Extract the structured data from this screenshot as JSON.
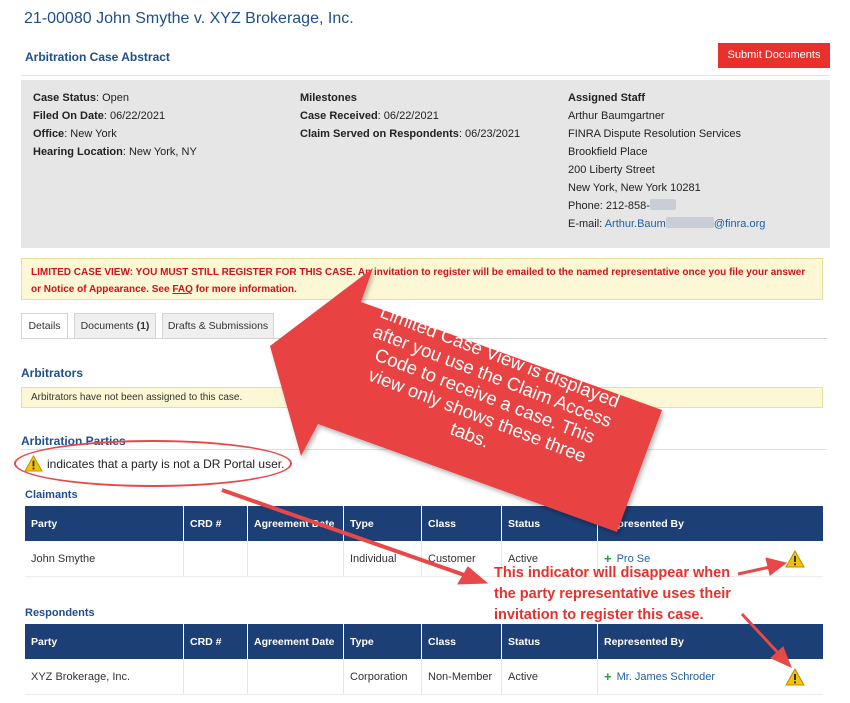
{
  "header": {
    "case_title": "21-00080 John Smythe v. XYZ Brokerage, Inc.",
    "abstract_title": "Arbitration Case Abstract",
    "submit_label": "Submit Documents"
  },
  "summary": {
    "case_status_label": "Case Status",
    "case_status_value": ": Open",
    "filed_label": "Filed On Date",
    "filed_value": ": 06/22/2021",
    "office_label": "Office",
    "office_value": ": New York",
    "hearing_label": "Hearing Location",
    "hearing_value": ": New York, NY",
    "milestones_title": "Milestones",
    "received_label": "Case Received",
    "received_value": ": 06/22/2021",
    "served_label": "Claim Served on Respondents",
    "served_value": ": 06/23/2021",
    "staff_title": "Assigned Staff",
    "staff_lines": [
      "Arthur Baumgartner",
      "FINRA Dispute Resolution Services",
      "Brookfield Place",
      "200 Liberty Street",
      "New York, New York 10281"
    ],
    "phone_label": "Phone: 212-858-",
    "email_label": "E-mail: ",
    "email_prefix": "Arthur.Baum",
    "email_suffix": "@finra.org"
  },
  "limited_notice": {
    "text": "LIMITED CASE VIEW: YOU MUST STILL REGISTER FOR THIS CASE. An invitation to register will be emailed to the named representative once you file your answer or Notice of Appearance. See ",
    "faq": "FAQ",
    "tail": " for more information."
  },
  "tabs": [
    {
      "label": "Details"
    },
    {
      "label": "Documents ",
      "count": "(1)"
    },
    {
      "label": "Drafts & Submissions"
    }
  ],
  "arbitrators": {
    "title": "Arbitrators",
    "message": "Arbitrators have not been assigned to this case."
  },
  "parties": {
    "title": "Arbitration Parties",
    "legend": "indicates that a party is not a DR Portal user.",
    "columns": [
      "Party",
      "CRD #",
      "Agreement Date",
      "Type",
      "Class",
      "Status",
      "Represented By"
    ],
    "claimants_title": "Claimants",
    "claimant": {
      "party": "John Smythe",
      "crd": "",
      "agreement": "",
      "type": "Individual",
      "class": "Customer",
      "status": "Active",
      "rep": "Pro Se"
    },
    "respondents_title": "Respondents",
    "respondent": {
      "party": "XYZ Brokerage, Inc.",
      "crd": "",
      "agreement": "",
      "type": "Corporation",
      "class": "Non-Member",
      "status": "Active",
      "rep": "Mr. James Schroder"
    }
  },
  "annotations": {
    "callout_text": "Limited Case View is displayed after you use the Claim Access Code to receive a case. This view only shows these three tabs.",
    "indicator_lines": [
      "This indicator will disappear when",
      "the party representative uses their",
      "invitation to register this case."
    ]
  },
  "colors": {
    "accent_blue": "#1f4e8c",
    "table_header": "#1c3f76",
    "submit_red": "#e8302d",
    "warn_yellow": "#fcf8d6",
    "annotation_red": "#e84848"
  }
}
